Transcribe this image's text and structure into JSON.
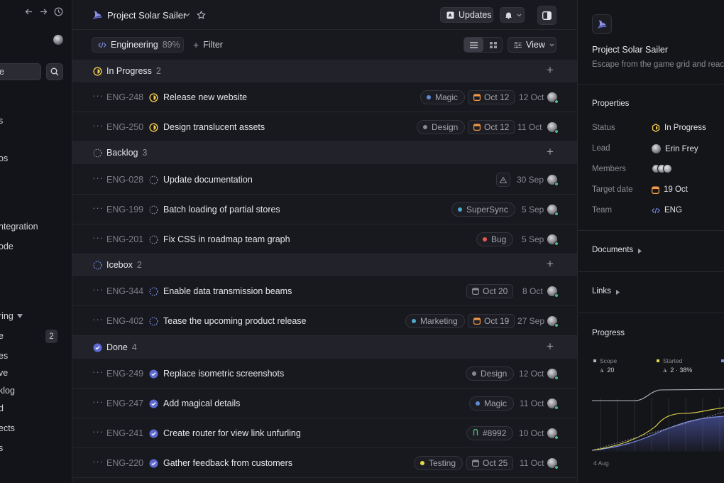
{
  "sidebar": {
    "search_value": "e",
    "items": [
      {
        "label": "s"
      },
      {
        "label": "os"
      },
      {
        "label": "ntegration"
      },
      {
        "label": "ode"
      },
      {
        "label": "ring"
      },
      {
        "label": "e",
        "badge": "2"
      },
      {
        "label": "es"
      },
      {
        "label": "ve"
      },
      {
        "label": "klog"
      },
      {
        "label": "d"
      },
      {
        "label": "ects"
      },
      {
        "label": "s"
      }
    ]
  },
  "header": {
    "project_title": "Project Solar Sailer",
    "updates_label": "Updates"
  },
  "toolbar": {
    "team_label": "Engineering",
    "team_progress": "89%",
    "filter_label": "Filter",
    "view_label": "View"
  },
  "groups": [
    {
      "name": "In Progress",
      "count": "2",
      "status": "in-progress"
    },
    {
      "name": "Backlog",
      "count": "3",
      "status": "backlog"
    },
    {
      "name": "Icebox",
      "count": "2",
      "status": "icebox"
    },
    {
      "name": "Done",
      "count": "4",
      "status": "done"
    }
  ],
  "issues": [
    {
      "id": "ENG-248",
      "title": "Release new website",
      "status": "in-progress",
      "label": "Magic",
      "label_color": "#5e8bd8",
      "due": "Oct 12",
      "due_color": "#f2994a",
      "date": "12 Oct"
    },
    {
      "id": "ENG-250",
      "title": "Design translucent assets",
      "status": "in-progress",
      "label": "Design",
      "label_color": "#8a8b93",
      "due": "Oct 12",
      "due_color": "#f2994a",
      "date": "11 Oct"
    },
    {
      "id": "ENG-028",
      "title": "Update documentation",
      "status": "backlog",
      "date": "30 Sep"
    },
    {
      "id": "ENG-199",
      "title": "Batch loading of partial stores",
      "status": "backlog",
      "label": "SuperSync",
      "label_color": "#4ea7c7",
      "date": "5 Sep"
    },
    {
      "id": "ENG-201",
      "title": "Fix CSS in roadmap team graph",
      "status": "backlog",
      "label": "Bug",
      "label_color": "#eb5757",
      "date": "5 Sep"
    },
    {
      "id": "ENG-344",
      "title": "Enable data transmission beams",
      "status": "icebox",
      "due": "Oct 20",
      "due_color": "#8a8b93",
      "date": "8 Oct"
    },
    {
      "id": "ENG-402",
      "title": "Tease the upcoming product release",
      "status": "icebox",
      "label": "Marketing",
      "label_color": "#4ea7c7",
      "due": "Oct 19",
      "due_color": "#f2994a",
      "date": "27 Sep"
    },
    {
      "id": "ENG-249",
      "title": "Replace isometric screenshots",
      "status": "done",
      "label": "Design",
      "label_color": "#8a8b93",
      "date": "12 Oct"
    },
    {
      "id": "ENG-247",
      "title": "Add magical details",
      "status": "done",
      "label": "Magic",
      "label_color": "#5e8bd8",
      "date": "11 Oct"
    },
    {
      "id": "ENG-241",
      "title": "Create router for view link unfurling",
      "status": "done",
      "label": "#8992",
      "label_color": "#4cb782",
      "date": "10 Oct"
    },
    {
      "id": "ENG-220",
      "title": "Gather feedback from customers",
      "status": "done",
      "label": "Testing",
      "label_color": "#e5d94b",
      "due": "Oct 25",
      "due_color": "#8a8b93",
      "date": "11 Oct"
    }
  ],
  "panel": {
    "project_title": "Project Solar Sailer",
    "description": "Escape from the game grid and reach",
    "properties_heading": "Properties",
    "status_label": "Status",
    "status_value": "In Progress",
    "lead_label": "Lead",
    "lead_value": "Erin Frey",
    "members_label": "Members",
    "target_label": "Target date",
    "target_value": "19 Oct",
    "team_label": "Team",
    "team_value": "ENG",
    "documents_heading": "Documents",
    "links_heading": "Links",
    "progress_heading": "Progress",
    "scope_label": "Scope",
    "scope_value": "20",
    "started_label": "Started",
    "started_value": "2 · 38%",
    "axis_start": "4 Aug"
  },
  "colors": {
    "in_progress": "#f2c94c",
    "done": "#5e6ad2",
    "accent": "#5e6ad2"
  }
}
